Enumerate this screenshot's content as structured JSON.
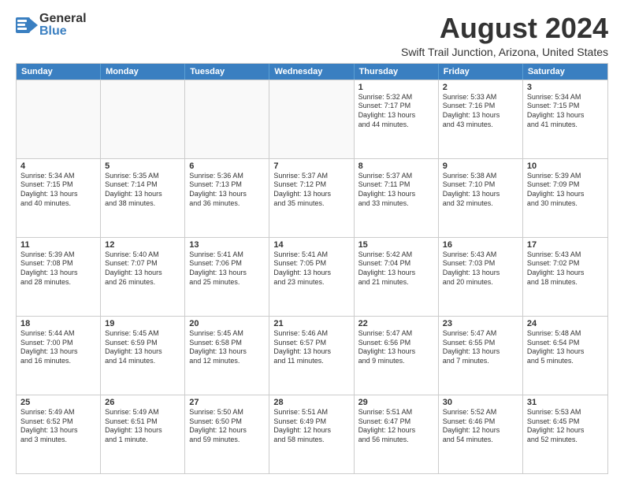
{
  "logo": {
    "line1": "General",
    "line2": "Blue"
  },
  "title": "August 2024",
  "location": "Swift Trail Junction, Arizona, United States",
  "headers": [
    "Sunday",
    "Monday",
    "Tuesday",
    "Wednesday",
    "Thursday",
    "Friday",
    "Saturday"
  ],
  "rows": [
    [
      {
        "day": "",
        "info": "",
        "empty": true
      },
      {
        "day": "",
        "info": "",
        "empty": true
      },
      {
        "day": "",
        "info": "",
        "empty": true
      },
      {
        "day": "",
        "info": "",
        "empty": true
      },
      {
        "day": "1",
        "info": "Sunrise: 5:32 AM\nSunset: 7:17 PM\nDaylight: 13 hours\nand 44 minutes.",
        "empty": false
      },
      {
        "day": "2",
        "info": "Sunrise: 5:33 AM\nSunset: 7:16 PM\nDaylight: 13 hours\nand 43 minutes.",
        "empty": false
      },
      {
        "day": "3",
        "info": "Sunrise: 5:34 AM\nSunset: 7:15 PM\nDaylight: 13 hours\nand 41 minutes.",
        "empty": false
      }
    ],
    [
      {
        "day": "4",
        "info": "Sunrise: 5:34 AM\nSunset: 7:15 PM\nDaylight: 13 hours\nand 40 minutes.",
        "empty": false
      },
      {
        "day": "5",
        "info": "Sunrise: 5:35 AM\nSunset: 7:14 PM\nDaylight: 13 hours\nand 38 minutes.",
        "empty": false
      },
      {
        "day": "6",
        "info": "Sunrise: 5:36 AM\nSunset: 7:13 PM\nDaylight: 13 hours\nand 36 minutes.",
        "empty": false
      },
      {
        "day": "7",
        "info": "Sunrise: 5:37 AM\nSunset: 7:12 PM\nDaylight: 13 hours\nand 35 minutes.",
        "empty": false
      },
      {
        "day": "8",
        "info": "Sunrise: 5:37 AM\nSunset: 7:11 PM\nDaylight: 13 hours\nand 33 minutes.",
        "empty": false
      },
      {
        "day": "9",
        "info": "Sunrise: 5:38 AM\nSunset: 7:10 PM\nDaylight: 13 hours\nand 32 minutes.",
        "empty": false
      },
      {
        "day": "10",
        "info": "Sunrise: 5:39 AM\nSunset: 7:09 PM\nDaylight: 13 hours\nand 30 minutes.",
        "empty": false
      }
    ],
    [
      {
        "day": "11",
        "info": "Sunrise: 5:39 AM\nSunset: 7:08 PM\nDaylight: 13 hours\nand 28 minutes.",
        "empty": false
      },
      {
        "day": "12",
        "info": "Sunrise: 5:40 AM\nSunset: 7:07 PM\nDaylight: 13 hours\nand 26 minutes.",
        "empty": false
      },
      {
        "day": "13",
        "info": "Sunrise: 5:41 AM\nSunset: 7:06 PM\nDaylight: 13 hours\nand 25 minutes.",
        "empty": false
      },
      {
        "day": "14",
        "info": "Sunrise: 5:41 AM\nSunset: 7:05 PM\nDaylight: 13 hours\nand 23 minutes.",
        "empty": false
      },
      {
        "day": "15",
        "info": "Sunrise: 5:42 AM\nSunset: 7:04 PM\nDaylight: 13 hours\nand 21 minutes.",
        "empty": false
      },
      {
        "day": "16",
        "info": "Sunrise: 5:43 AM\nSunset: 7:03 PM\nDaylight: 13 hours\nand 20 minutes.",
        "empty": false
      },
      {
        "day": "17",
        "info": "Sunrise: 5:43 AM\nSunset: 7:02 PM\nDaylight: 13 hours\nand 18 minutes.",
        "empty": false
      }
    ],
    [
      {
        "day": "18",
        "info": "Sunrise: 5:44 AM\nSunset: 7:00 PM\nDaylight: 13 hours\nand 16 minutes.",
        "empty": false
      },
      {
        "day": "19",
        "info": "Sunrise: 5:45 AM\nSunset: 6:59 PM\nDaylight: 13 hours\nand 14 minutes.",
        "empty": false
      },
      {
        "day": "20",
        "info": "Sunrise: 5:45 AM\nSunset: 6:58 PM\nDaylight: 13 hours\nand 12 minutes.",
        "empty": false
      },
      {
        "day": "21",
        "info": "Sunrise: 5:46 AM\nSunset: 6:57 PM\nDaylight: 13 hours\nand 11 minutes.",
        "empty": false
      },
      {
        "day": "22",
        "info": "Sunrise: 5:47 AM\nSunset: 6:56 PM\nDaylight: 13 hours\nand 9 minutes.",
        "empty": false
      },
      {
        "day": "23",
        "info": "Sunrise: 5:47 AM\nSunset: 6:55 PM\nDaylight: 13 hours\nand 7 minutes.",
        "empty": false
      },
      {
        "day": "24",
        "info": "Sunrise: 5:48 AM\nSunset: 6:54 PM\nDaylight: 13 hours\nand 5 minutes.",
        "empty": false
      }
    ],
    [
      {
        "day": "25",
        "info": "Sunrise: 5:49 AM\nSunset: 6:52 PM\nDaylight: 13 hours\nand 3 minutes.",
        "empty": false
      },
      {
        "day": "26",
        "info": "Sunrise: 5:49 AM\nSunset: 6:51 PM\nDaylight: 13 hours\nand 1 minute.",
        "empty": false
      },
      {
        "day": "27",
        "info": "Sunrise: 5:50 AM\nSunset: 6:50 PM\nDaylight: 12 hours\nand 59 minutes.",
        "empty": false
      },
      {
        "day": "28",
        "info": "Sunrise: 5:51 AM\nSunset: 6:49 PM\nDaylight: 12 hours\nand 58 minutes.",
        "empty": false
      },
      {
        "day": "29",
        "info": "Sunrise: 5:51 AM\nSunset: 6:47 PM\nDaylight: 12 hours\nand 56 minutes.",
        "empty": false
      },
      {
        "day": "30",
        "info": "Sunrise: 5:52 AM\nSunset: 6:46 PM\nDaylight: 12 hours\nand 54 minutes.",
        "empty": false
      },
      {
        "day": "31",
        "info": "Sunrise: 5:53 AM\nSunset: 6:45 PM\nDaylight: 12 hours\nand 52 minutes.",
        "empty": false
      }
    ]
  ]
}
